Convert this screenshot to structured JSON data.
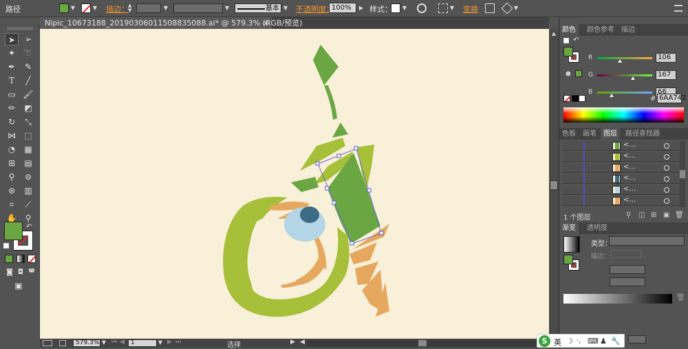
{
  "control_bar": {
    "object_type": "路径",
    "stroke_label": "描边：",
    "stroke_style_label": "基本",
    "opacity_label": "不透明度：",
    "opacity_value": "100%",
    "style_label": "样式：",
    "transform_label": "变换",
    "fill_color": "#6aa742"
  },
  "document": {
    "tab_title": "Nipic_10673188_20190306011508835088.ai* @ 579.3% (RGB/预览)",
    "close_label": "×"
  },
  "status_bar": {
    "zoom": "579.3%",
    "page": "1",
    "tool_status": "选择"
  },
  "color_panel": {
    "tabs": [
      "颜色",
      "颜色参考",
      "描边"
    ],
    "channels": [
      {
        "name": "R",
        "value": "106",
        "fraction": 0.415
      },
      {
        "name": "G",
        "value": "167",
        "fraction": 0.655
      },
      {
        "name": "B",
        "value": "66",
        "fraction": 0.259
      }
    ],
    "hex_label": "#",
    "hex_value": "6AA742"
  },
  "layers_panel": {
    "tabs": [
      "色板",
      "画笔",
      "图层",
      "路径查找器"
    ],
    "rows": [
      "<...",
      "<...",
      "<...",
      "<...",
      "<...",
      "<..."
    ],
    "count_label": "1 个图层"
  },
  "gradient_panel": {
    "tabs": [
      "渐变",
      "透明度"
    ],
    "type_label": "类型：",
    "stroke_label": "描边："
  },
  "ime": {
    "lang": "英"
  },
  "colors": {
    "leaf_green": "#6aa742",
    "lime": "#a7c03a",
    "orange": "#e6a85e",
    "eye_blue": "#b5d6e6",
    "pupil": "#3d6b85",
    "canvas": "#f8f0d8"
  }
}
